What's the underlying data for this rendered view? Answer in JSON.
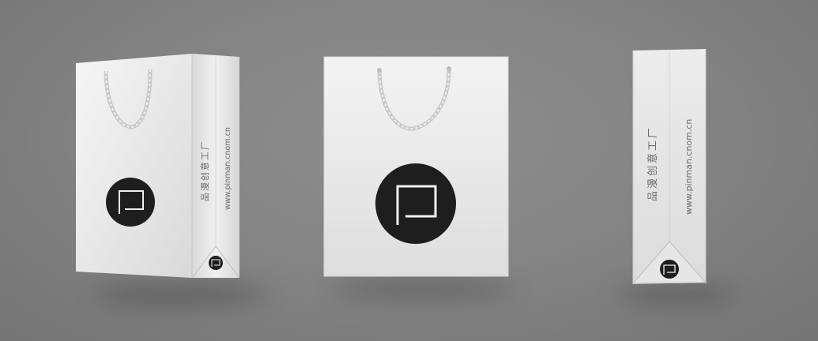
{
  "brand": {
    "website": "www.pinman.cnom.cn",
    "name_cn": "品漫创意工厂"
  },
  "colors": {
    "background": "#858585",
    "bag_white": "#ededed",
    "logo_black": "#1e1e1e"
  },
  "views": [
    {
      "label": "perspective-view"
    },
    {
      "label": "front-view"
    },
    {
      "label": "side-view"
    }
  ]
}
